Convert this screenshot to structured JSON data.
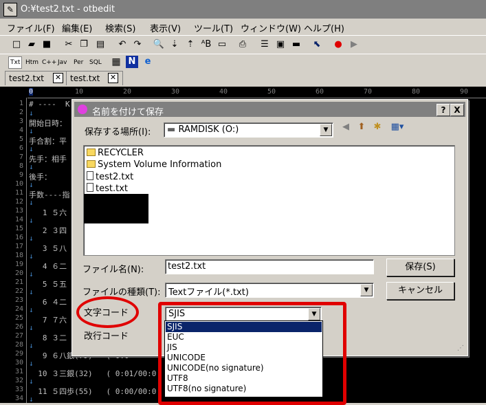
{
  "window": {
    "title": "O:¥test2.txt - otbedit"
  },
  "menu": [
    "ファイル(F)",
    "編集(E)",
    "検索(S)",
    "表示(V)",
    "ツール(T)",
    "ウィンドウ(W)",
    "ヘルプ(H)"
  ],
  "toolbar2": [
    "Txt",
    "Htm",
    "C++",
    "Jav",
    "Per",
    "SQL"
  ],
  "tabs": [
    "test2.txt",
    "test.txt"
  ],
  "ruler": [
    "0",
    "10",
    "20",
    "30",
    "40",
    "50",
    "60",
    "70",
    "80",
    "90"
  ],
  "editor": {
    "line_numbers": [
      "1",
      "2",
      "3",
      "4",
      "5",
      "6",
      "7",
      "8",
      "9",
      "10",
      "11",
      "12",
      "13",
      "14",
      "15",
      "16",
      "17",
      "18",
      "19",
      "20",
      "21",
      "22",
      "23",
      "24",
      "25",
      "26",
      "27",
      "28",
      "29",
      "30",
      "31",
      "32",
      "33",
      "34"
    ],
    "lines": [
      "# ----  K",
      "↓",
      "開始日時：",
      "↓",
      "手合割：平",
      "↓",
      "先手：相手",
      "↓",
      "後手：",
      "↓",
      "手数----指",
      "↓",
      "   1 ５六",
      "↓",
      "   2 ３四",
      "↓",
      "   3 ５八",
      "↓",
      "   4 ６二",
      "↓",
      "   5 ５五",
      "↓",
      "   6 ４二",
      "↓",
      "   7 ７六",
      "↓",
      "   8 ３二",
      "↓",
      "   9 ６八銀(79)   ( 0:0",
      "↓",
      "  10 ３三銀(32)   ( 0:01/00:0",
      "↓",
      "  11 ５四歩(55)   ( 0:00/00:0",
      "↓"
    ]
  },
  "dialog": {
    "title": "名前を付けて保存",
    "help_btn": "?",
    "close_btn": "X",
    "location_label": "保存する場所(I):",
    "location_value": "RAMDISK (O:)",
    "files": [
      {
        "name": "RECYCLER",
        "type": "folder"
      },
      {
        "name": "System Volume Information",
        "type": "folder"
      },
      {
        "name": "test2.txt",
        "type": "file"
      },
      {
        "name": "test.txt",
        "type": "file"
      }
    ],
    "filename_label": "ファイル名(N):",
    "filename_value": "test2.txt",
    "filetype_label": "ファイルの種類(T):",
    "filetype_value": "Textファイル(*.txt)",
    "encoding_label": "文字コード",
    "encoding_value": "SJIS",
    "newline_label": "改行コード",
    "save_btn": "保存(S)",
    "cancel_btn": "キャンセル",
    "encoding_options": [
      "SJIS",
      "EUC",
      "JIS",
      "UNICODE",
      "UNICODE(no signature)",
      "UTF8",
      "UTF8(no signature)"
    ],
    "encoding_selected_index": 0
  },
  "colors": {
    "highlight": "#0a246a",
    "annotation": "#e00000"
  }
}
